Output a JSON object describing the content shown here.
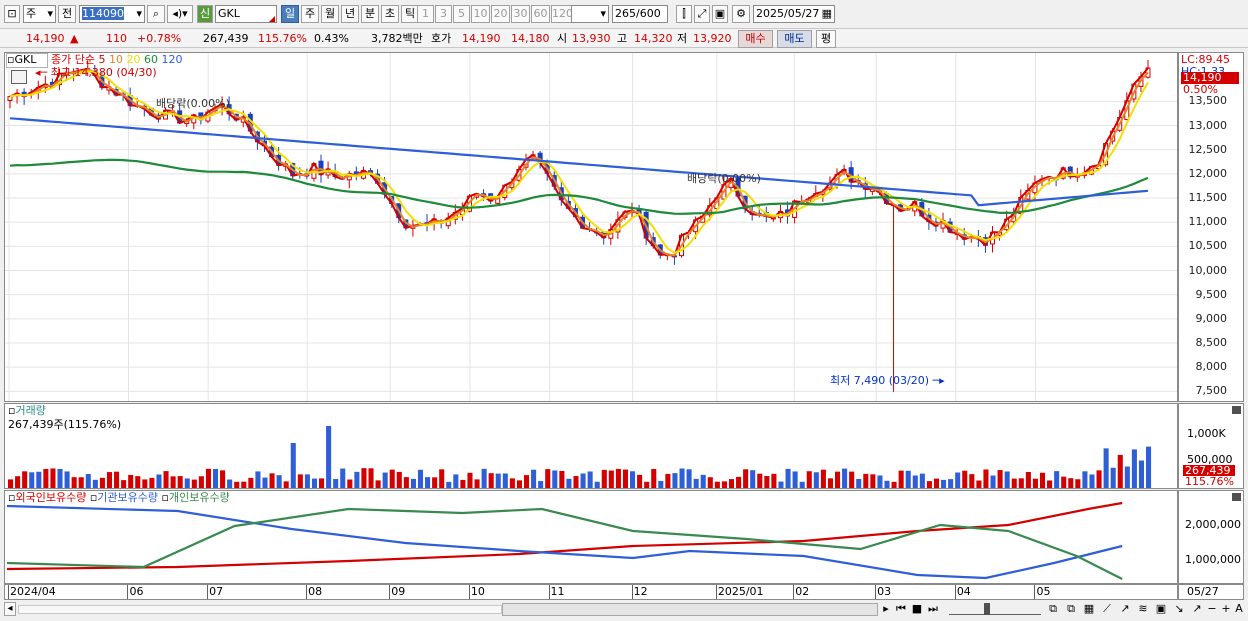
{
  "toolbar": {
    "period_label": "주",
    "prefix_label": "전",
    "code_value": "114090",
    "credit_badge": "신",
    "name_value": "GKL",
    "period_buttons": [
      "일",
      "주",
      "월",
      "년",
      "분",
      "초",
      "틱"
    ],
    "active_period": "일",
    "interval_buttons": [
      "1",
      "3",
      "5",
      "10",
      "20",
      "30",
      "60",
      "120"
    ],
    "count_value": "265",
    "count_total": "/600",
    "date_value": "2025/05/27"
  },
  "quote": {
    "price": "14,190",
    "change": "110",
    "change_pct": "+0.78%",
    "volume": "267,439",
    "volume_ratio": "115.76%",
    "turnover": "0.43%",
    "amount": "3,782백만",
    "ask_label": "호가",
    "ask1": "14,190",
    "ask2": "14,180",
    "open_label": "시",
    "open": "13,930",
    "high_label": "고",
    "high": "14,320",
    "low_label": "저",
    "low": "13,920",
    "buy_button": "매수",
    "sell_button": "매도",
    "eval_button": "평"
  },
  "price_panel": {
    "symbol": "GKL",
    "ma_label": "종가 단순",
    "ma_periods": [
      "5",
      "10",
      "20",
      "60",
      "120"
    ],
    "ma_colors": [
      "#d40000",
      "#e8822a",
      "#f1e000",
      "#1f8a3a",
      "#2f5fd6"
    ],
    "max_note": "최고 14,380 (04/30)",
    "min_note": "최저 7,490 (03/20)",
    "dividend_notes": [
      "배당락(0.00%)",
      "배당락(0.00%)"
    ],
    "lc_label": "LC:89.45",
    "hc_label": "HC:1.33",
    "current_price_tag": "14,190",
    "pct_tag": "0.50%",
    "y_ticks": [
      "13,500",
      "13,000",
      "12,500",
      "12,000",
      "11,500",
      "11,000",
      "10,500",
      "10,000",
      "9,500",
      "9,000",
      "8,500",
      "8,000",
      "7,500"
    ]
  },
  "volume_panel": {
    "title": "거래량",
    "value_text": "267,439주(115.76%)",
    "y_ticks": [
      "1,000K",
      "500,000"
    ],
    "current_tag": "267,439",
    "pct_tag": "115.76%"
  },
  "holdings_panel": {
    "series_labels": [
      "외국인보유수량",
      "기관보유수량",
      "개인보유수량"
    ],
    "series_colors": [
      "#d40000",
      "#2f5fd6",
      "#3a8a50"
    ],
    "y_ticks": [
      "2,000,000",
      "1,000,000"
    ]
  },
  "x_axis": {
    "labels": [
      "2024/04",
      "06",
      "07",
      "08",
      "09",
      "10",
      "11",
      "12",
      "2025/01",
      "02",
      "03",
      "04",
      "05"
    ],
    "end_label": "05/27"
  },
  "chart_data": {
    "type": "candlestick",
    "x_range": [
      "2024/04",
      "2025/05/27"
    ],
    "ylim": [
      7300,
      14500
    ],
    "close_path": [
      [
        0,
        13600
      ],
      [
        6,
        13900
      ],
      [
        10,
        14200
      ],
      [
        14,
        13800
      ],
      [
        18,
        13400
      ],
      [
        22,
        13200
      ],
      [
        26,
        13100
      ],
      [
        28,
        13300
      ],
      [
        30,
        13400
      ],
      [
        32,
        13200
      ],
      [
        34,
        12900
      ],
      [
        37,
        12400
      ],
      [
        40,
        12000
      ],
      [
        43,
        12100
      ],
      [
        46,
        11950
      ],
      [
        50,
        12000
      ],
      [
        52,
        11900
      ],
      [
        54,
        11400
      ],
      [
        56,
        11000
      ],
      [
        58,
        10900
      ],
      [
        60,
        10950
      ],
      [
        62,
        11100
      ],
      [
        64,
        11300
      ],
      [
        66,
        11600
      ],
      [
        68,
        11500
      ],
      [
        70,
        11700
      ],
      [
        72,
        12150
      ],
      [
        74,
        12300
      ],
      [
        76,
        11900
      ],
      [
        78,
        11400
      ],
      [
        80,
        11100
      ],
      [
        82,
        10900
      ],
      [
        84,
        10750
      ],
      [
        86,
        11000
      ],
      [
        88,
        11300
      ],
      [
        90,
        10800
      ],
      [
        92,
        10300
      ],
      [
        94,
        10400
      ],
      [
        96,
        10800
      ],
      [
        98,
        11100
      ],
      [
        100,
        11600
      ],
      [
        102,
        11800
      ],
      [
        104,
        11400
      ],
      [
        106,
        11100
      ],
      [
        108,
        11050
      ],
      [
        110,
        11200
      ],
      [
        112,
        11500
      ],
      [
        114,
        11700
      ],
      [
        116,
        11800
      ],
      [
        118,
        12000
      ],
      [
        120,
        11850
      ],
      [
        122,
        11750
      ],
      [
        124,
        11500
      ],
      [
        126,
        11300
      ],
      [
        128,
        11350
      ],
      [
        130,
        11100
      ],
      [
        132,
        11000
      ],
      [
        134,
        10800
      ],
      [
        136,
        10700
      ],
      [
        138,
        10650
      ],
      [
        140,
        10800
      ],
      [
        142,
        11200
      ],
      [
        144,
        11600
      ],
      [
        146,
        11950
      ],
      [
        148,
        12000
      ],
      [
        150,
        12050
      ],
      [
        152,
        12100
      ],
      [
        154,
        12300
      ],
      [
        156,
        12900
      ],
      [
        158,
        13500
      ],
      [
        160,
        14000
      ],
      [
        161,
        14190
      ]
    ],
    "series": [
      {
        "name": "5",
        "color": "#d40000"
      },
      {
        "name": "10",
        "color": "#e8822a"
      },
      {
        "name": "20",
        "color": "#f1e000"
      },
      {
        "name": "60",
        "color": "#1f8a3a"
      },
      {
        "name": "120",
        "color": "#2f5fd6"
      }
    ],
    "annotations": [
      {
        "text": "최고 14,380 (04/30)",
        "value": 14380
      },
      {
        "text": "최저 7,490 (03/20)",
        "value": 7490
      }
    ]
  }
}
